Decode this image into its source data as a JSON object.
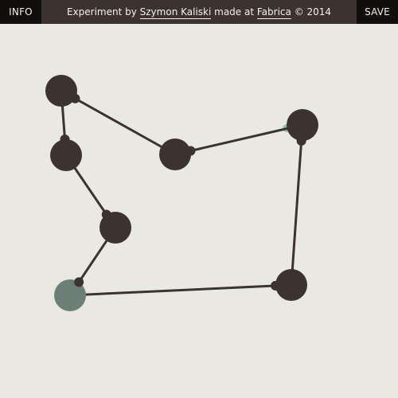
{
  "topbar": {
    "info_label": "INFO",
    "save_label": "SAVE",
    "credits_prefix": "Experiment by ",
    "author_name": "Szymon Kaliski",
    "credits_middle": " made at ",
    "studio_name": "Fabrica",
    "credits_suffix": " © 2014"
  },
  "colors": {
    "background": "#e9e8e1",
    "topbar": "#3c3330",
    "buttons": "#100f0e",
    "node": "#3c3330",
    "active_node": "#6b7f76",
    "accent_dot": "#8fbfb0",
    "edge": "#3c3330"
  },
  "graph": {
    "nodes": [
      {
        "id": "n1",
        "active": false
      },
      {
        "id": "n2",
        "active": false
      },
      {
        "id": "n3",
        "active": false
      },
      {
        "id": "n4",
        "active": false
      },
      {
        "id": "n5",
        "active": true
      },
      {
        "id": "n6",
        "active": false
      },
      {
        "id": "n7",
        "active": false
      },
      {
        "id": "n8",
        "active": false
      }
    ],
    "edges": [
      [
        "n1",
        "n2"
      ],
      [
        "n2",
        "n3"
      ],
      [
        "n3",
        "n4"
      ],
      [
        "n4",
        "n5"
      ],
      [
        "n5",
        "n6"
      ],
      [
        "n6",
        "n7"
      ],
      [
        "n7",
        "n8"
      ],
      [
        "n8",
        "n1"
      ]
    ]
  }
}
